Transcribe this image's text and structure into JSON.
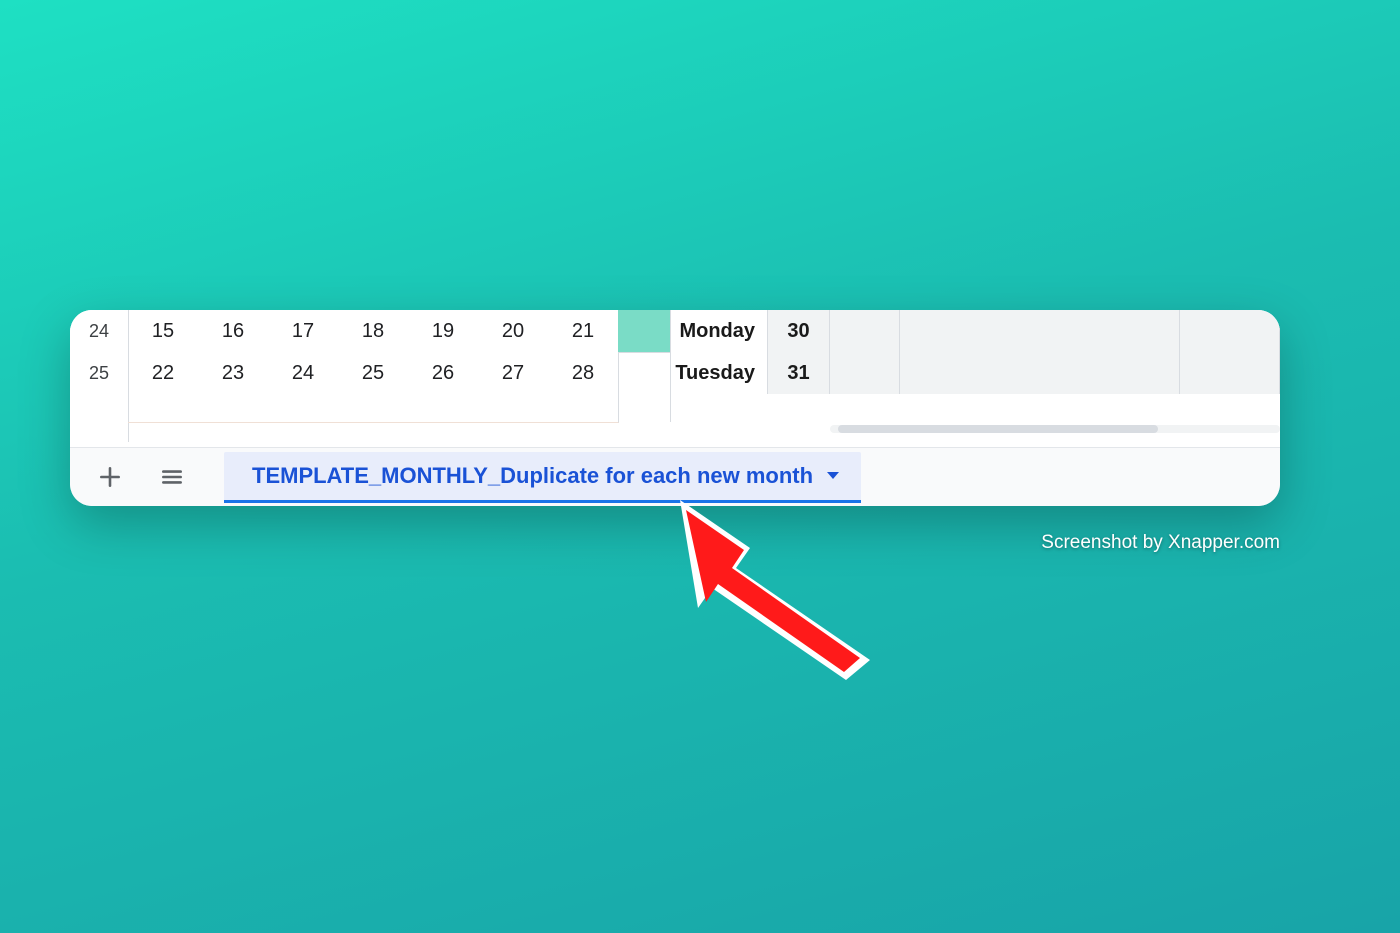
{
  "row_headers": [
    "24",
    "25"
  ],
  "calendar": {
    "row1": [
      "15",
      "16",
      "17",
      "18",
      "19",
      "20",
      "21"
    ],
    "row2": [
      "22",
      "23",
      "24",
      "25",
      "26",
      "27",
      "28"
    ]
  },
  "day_rows": [
    {
      "day": "Monday",
      "date": "30"
    },
    {
      "day": "Tuesday",
      "date": "31"
    }
  ],
  "sheet_tab": {
    "name": "TEMPLATE_MONTHLY_Duplicate for each new month"
  },
  "attribution": "Screenshot by Xnapper.com"
}
